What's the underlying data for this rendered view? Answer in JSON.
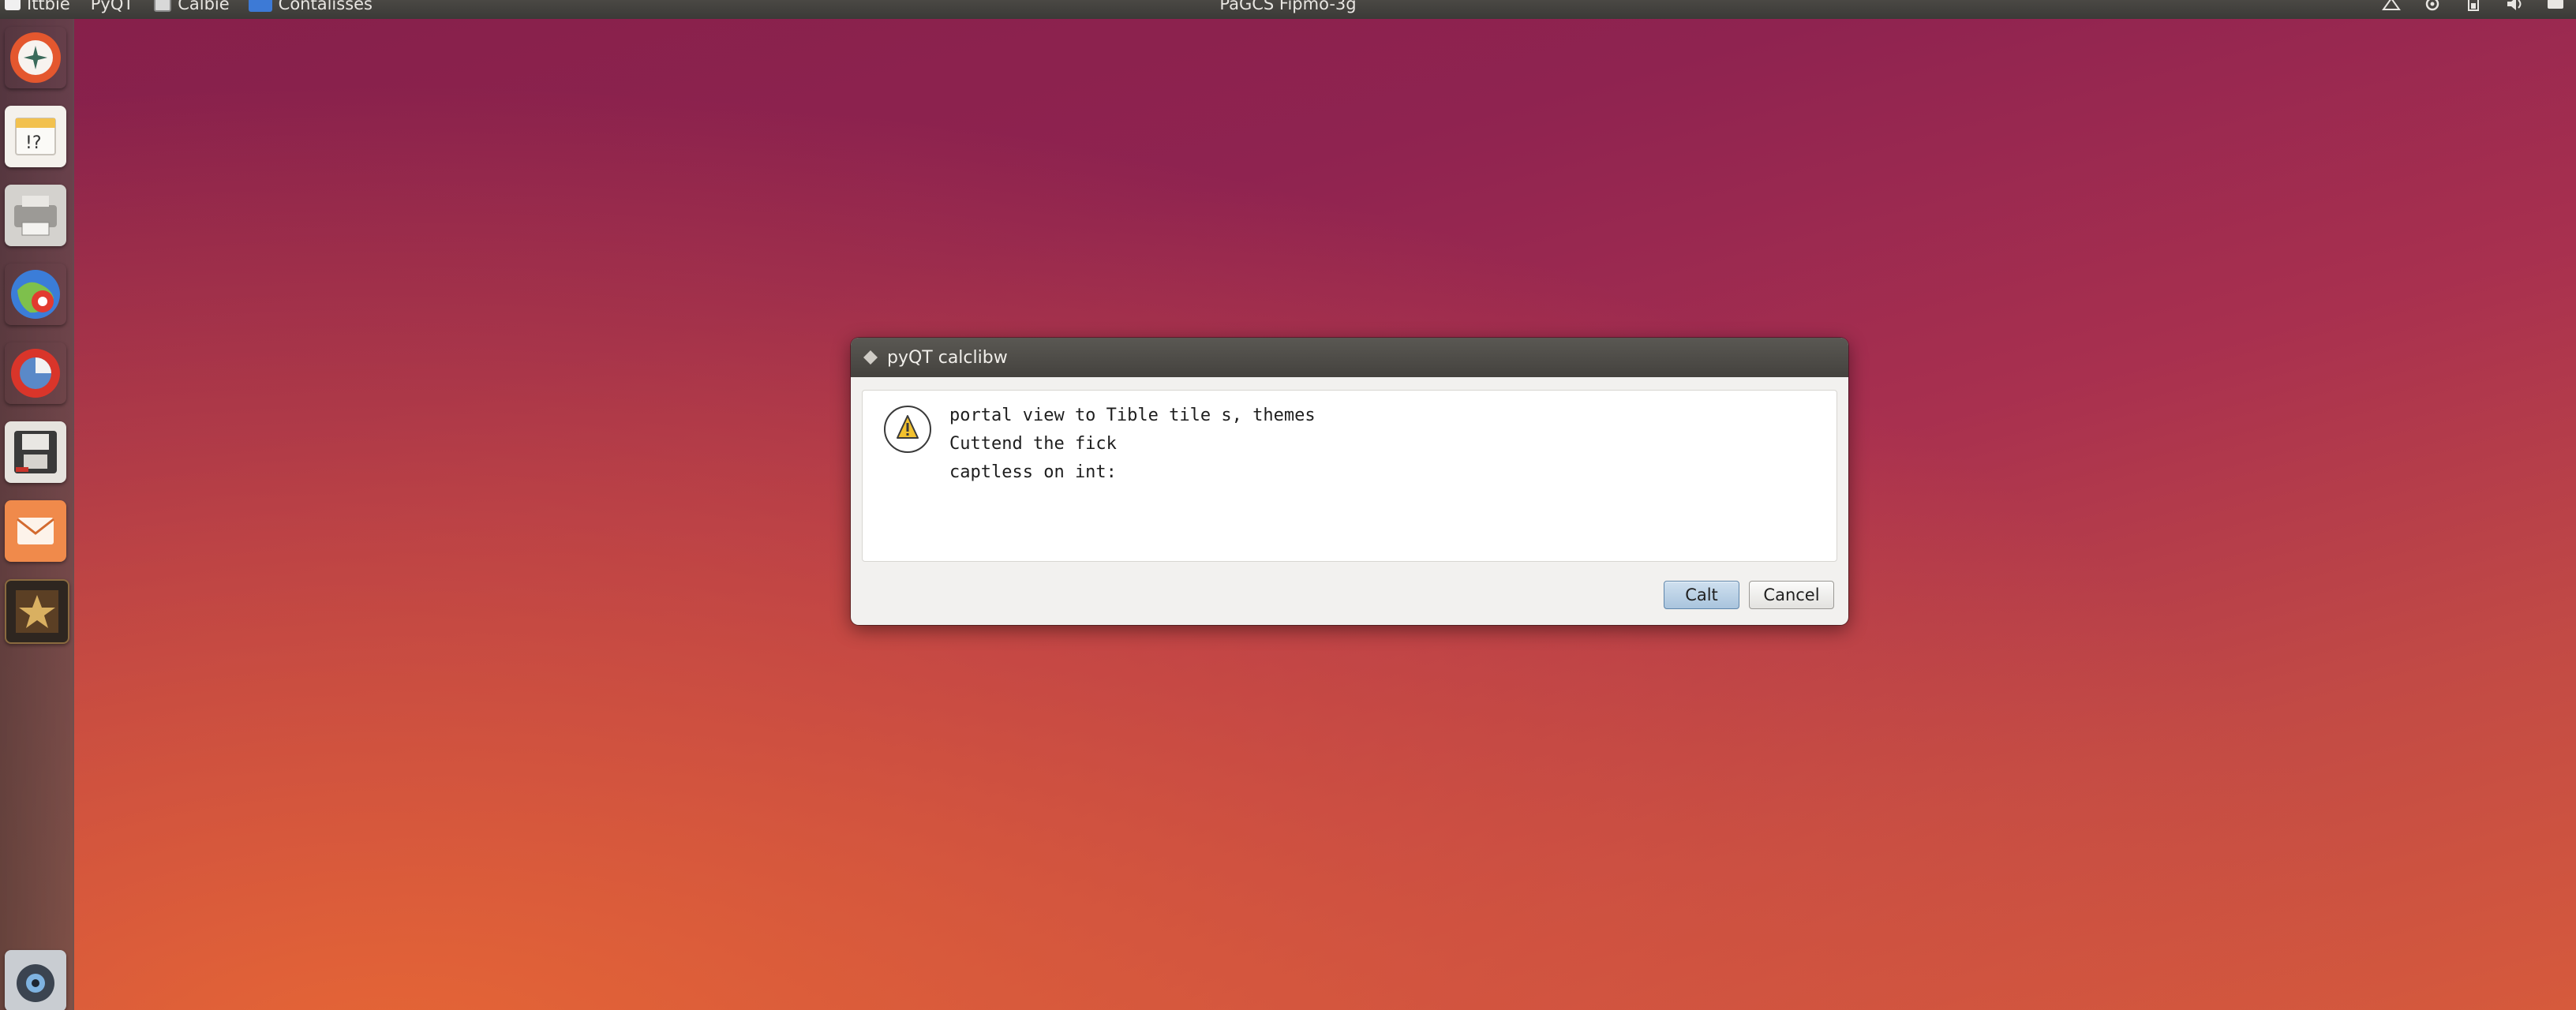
{
  "top_panel": {
    "menus": [
      {
        "label": "Ittbie",
        "icon": "app-square-icon"
      },
      {
        "label": "PyQT",
        "icon": ""
      },
      {
        "label": "Calbie",
        "icon": "calibre-icon"
      },
      {
        "label": "Contalisses",
        "icon": "check-folder-icon"
      }
    ],
    "title": "PaGCS Fipmo-3g",
    "tray_icons": [
      "network-icon",
      "settings-icon",
      "battery-icon",
      "sound-icon",
      "power-icon"
    ]
  },
  "launcher": {
    "items": [
      {
        "name": "launcher-dash-icon",
        "color": "#e4572e"
      },
      {
        "name": "launcher-files-icon",
        "color": "#f2c14e"
      },
      {
        "name": "launcher-printer-icon",
        "color": "#b9b9b9"
      },
      {
        "name": "launcher-browser-icon",
        "color": "#3b7dd8"
      },
      {
        "name": "launcher-software-icon",
        "color": "#d9352a"
      },
      {
        "name": "launcher-disk-icon",
        "color": "#d0cdc8"
      },
      {
        "name": "launcher-mail-icon",
        "color": "#f08a4b"
      },
      {
        "name": "launcher-star-icon",
        "color": "#6b4b2a"
      },
      {
        "name": "launcher-camera-icon",
        "color": "#9aa3ad"
      }
    ]
  },
  "dialog": {
    "title": "pyQT calclibw",
    "message_lines": [
      "portal view to Tible tile s, themes",
      "Cuttend the fick",
      "captless on int:"
    ],
    "ok_label": "Calt",
    "cancel_label": "Cancel",
    "icon": "warning-icon"
  },
  "colors": {
    "accent_button": "#a9c4dd",
    "panel": "#3b3a37",
    "wallpaper_top": "#86204a",
    "wallpaper_bottom": "#d65a3c"
  }
}
